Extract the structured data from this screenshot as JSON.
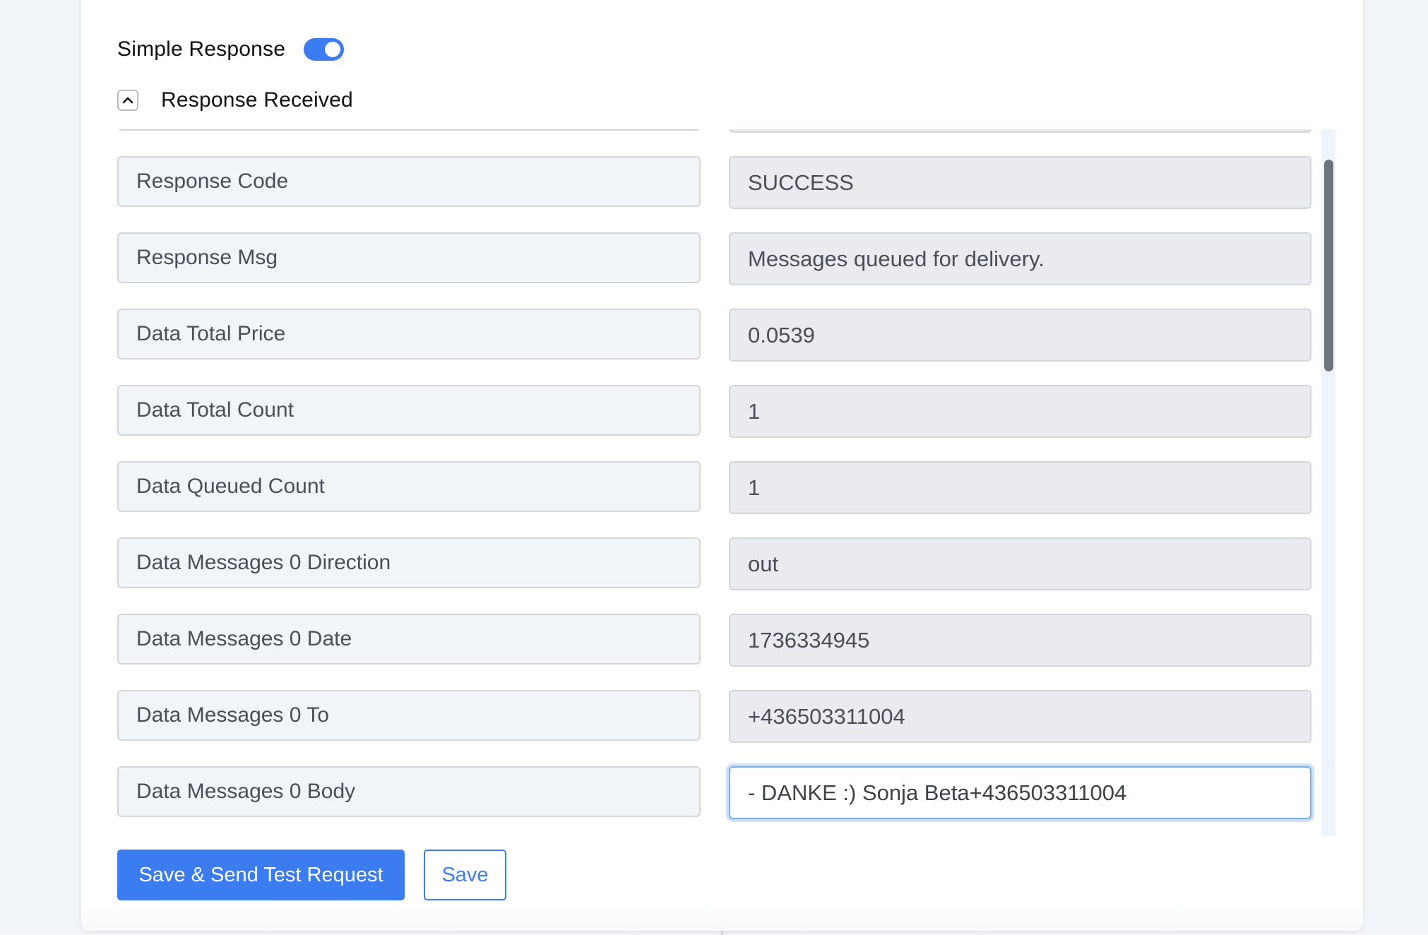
{
  "header": {
    "simple_response_label": "Simple Response",
    "simple_response_enabled": true,
    "section_title": "Response Received",
    "section_expanded": true
  },
  "rows": [
    {
      "key": "",
      "value": ""
    },
    {
      "key": "Response Code",
      "value": "SUCCESS"
    },
    {
      "key": "Response Msg",
      "value": "Messages queued for delivery."
    },
    {
      "key": "Data Total Price",
      "value": "0.0539"
    },
    {
      "key": "Data Total Count",
      "value": "1"
    },
    {
      "key": "Data Queued Count",
      "value": "1"
    },
    {
      "key": "Data Messages 0 Direction",
      "value": "out"
    },
    {
      "key": "Data Messages 0 Date",
      "value": "1736334945"
    },
    {
      "key": "Data Messages 0 To",
      "value": "+436503311004"
    },
    {
      "key": "Data Messages 0 Body",
      "value": "- DANKE :) Sonja Beta+436503311004",
      "focused": true
    }
  ],
  "actions": {
    "save_send_label": "Save & Send Test Request",
    "save_label": "Save"
  },
  "colors": {
    "accent": "#3b7cf0",
    "scrollbar_thumb": "#6d747c"
  }
}
